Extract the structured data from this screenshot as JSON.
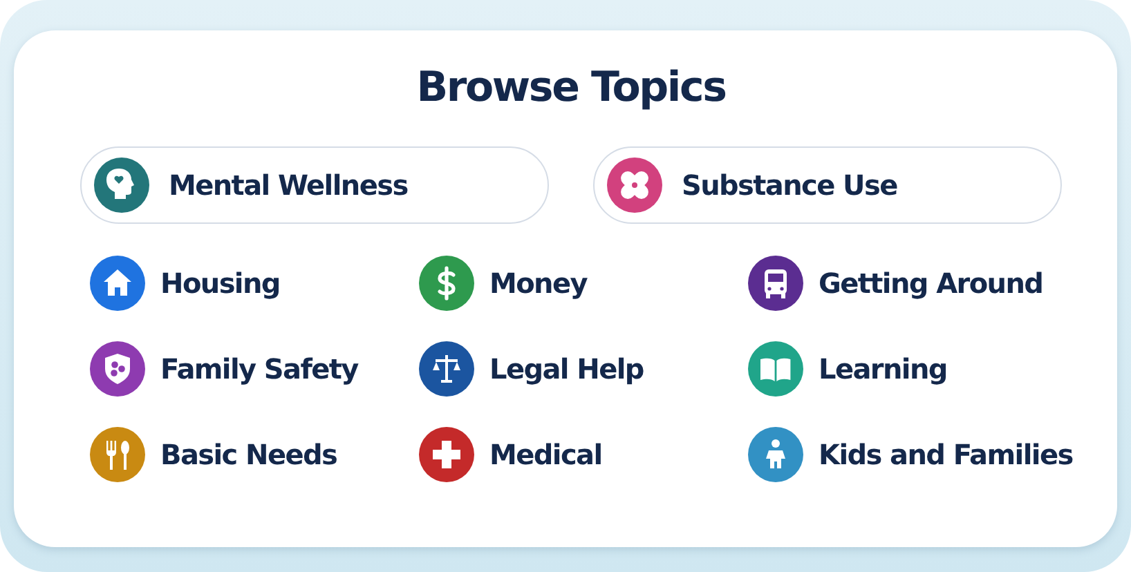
{
  "title": "Browse Topics",
  "featured": [
    {
      "label": "Mental Wellness",
      "color": "#23767a"
    },
    {
      "label": "Substance Use",
      "color": "#d2417e"
    }
  ],
  "topics": [
    {
      "label": "Housing",
      "color": "#1f73e0"
    },
    {
      "label": "Money",
      "color": "#2e9a4e"
    },
    {
      "label": "Getting Around",
      "color": "#5b2d91"
    },
    {
      "label": "Family Safety",
      "color": "#8e3bb0"
    },
    {
      "label": "Legal Help",
      "color": "#1b55a0"
    },
    {
      "label": "Learning",
      "color": "#20a58a"
    },
    {
      "label": "Basic Needs",
      "color": "#c98a12"
    },
    {
      "label": "Medical",
      "color": "#c42a2a"
    },
    {
      "label": "Kids and Families",
      "color": "#3291c4"
    }
  ]
}
